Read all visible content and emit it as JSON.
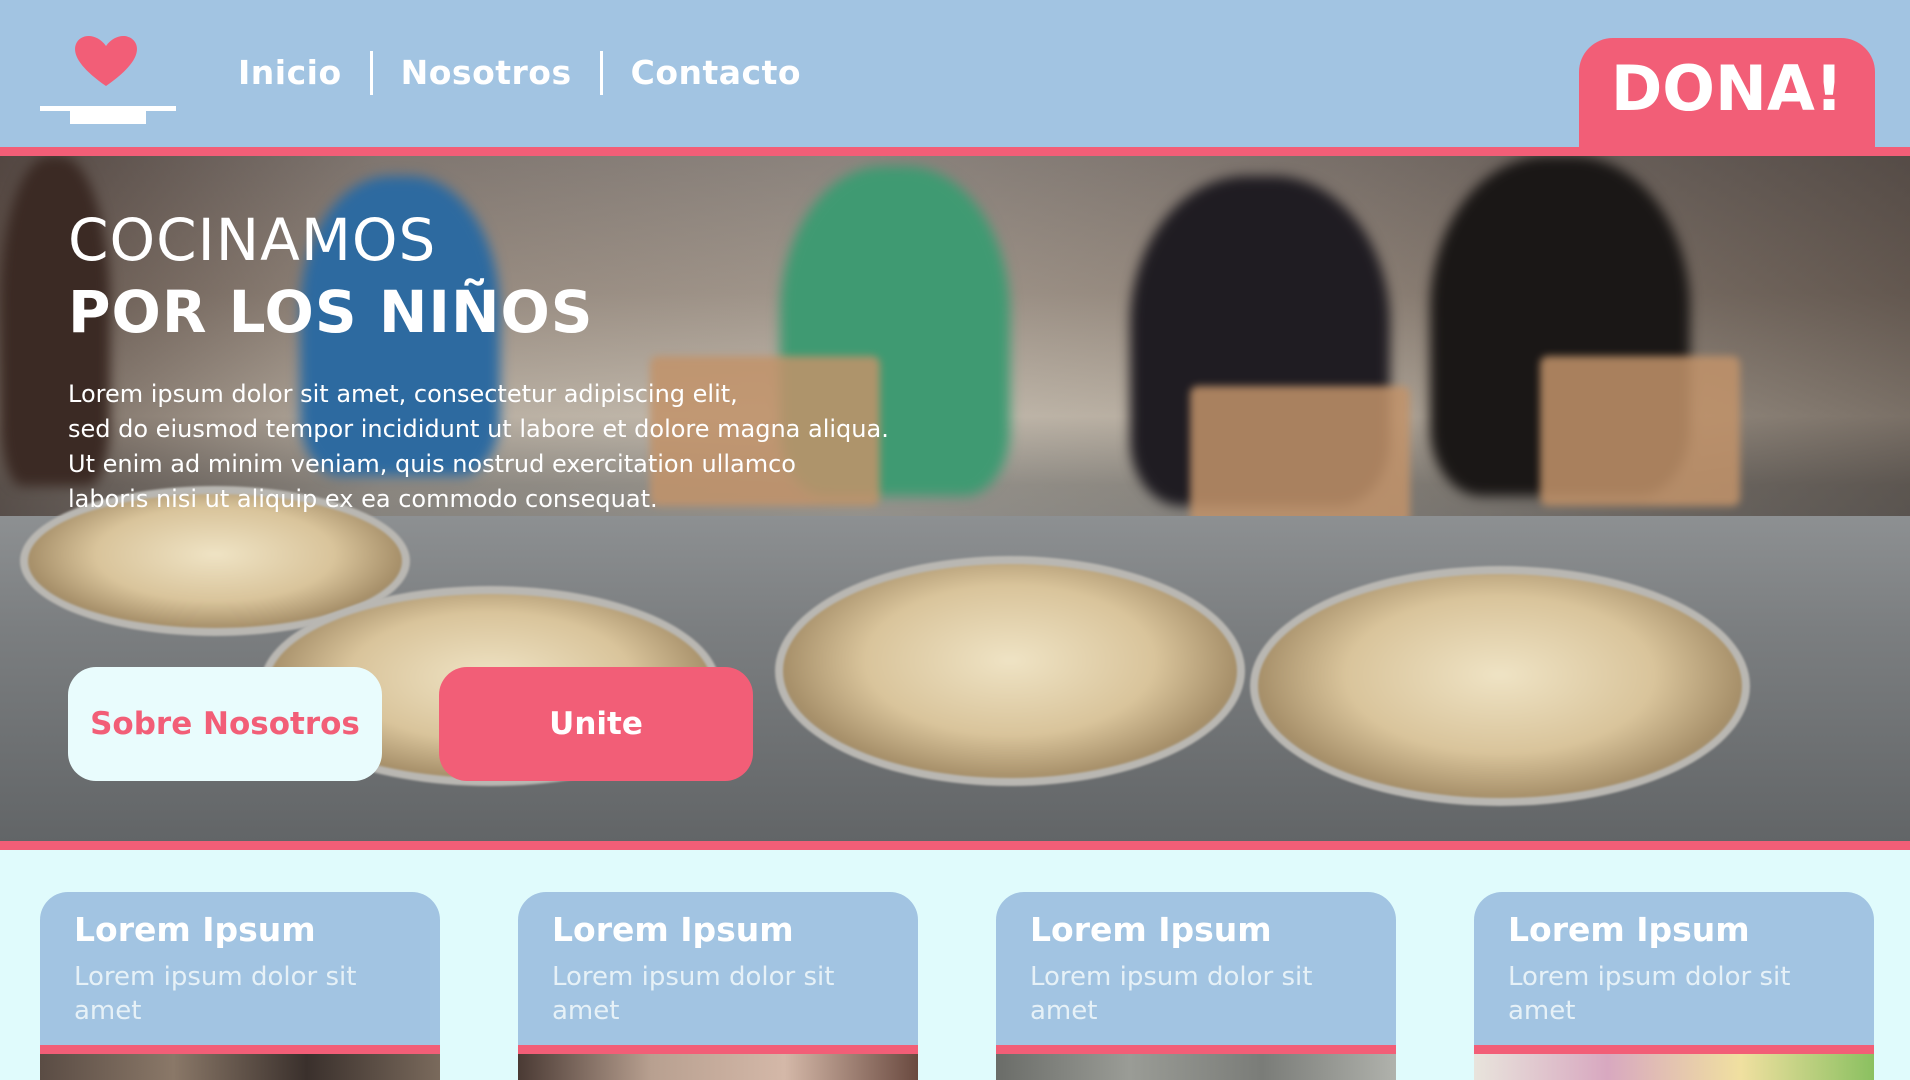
{
  "nav": {
    "items": [
      {
        "label": "Inicio"
      },
      {
        "label": "Nosotros"
      },
      {
        "label": "Contacto"
      }
    ]
  },
  "header": {
    "donate_label": "DONA!"
  },
  "hero": {
    "title_line1": "COCINAMOS",
    "title_line2": "POR LOS NIÑOS",
    "text_lines": [
      "Lorem ipsum dolor sit amet, consectetur adipiscing elit,",
      "sed do eiusmod tempor incididunt ut labore et dolore magna aliqua.",
      "Ut enim ad minim veniam, quis nostrud exercitation ullamco",
      "laboris nisi ut aliquip ex ea commodo consequat."
    ],
    "primary_button": "Sobre Nosotros",
    "secondary_button": "Unite"
  },
  "cards": [
    {
      "title": "Lorem Ipsum",
      "text": "Lorem ipsum dolor sit amet"
    },
    {
      "title": "Lorem Ipsum",
      "text": "Lorem ipsum dolor sit amet"
    },
    {
      "title": "Lorem Ipsum",
      "text": "Lorem ipsum dolor sit amet"
    },
    {
      "title": "Lorem Ipsum",
      "text": "Lorem ipsum dolor sit amet"
    }
  ],
  "colors": {
    "header_bg": "#a2c4e2",
    "accent": "#f25e77",
    "page_bg": "#e0fbfc",
    "light_button": "#e9fcfd"
  },
  "icons": {
    "logo": "heart-on-plate-icon"
  }
}
